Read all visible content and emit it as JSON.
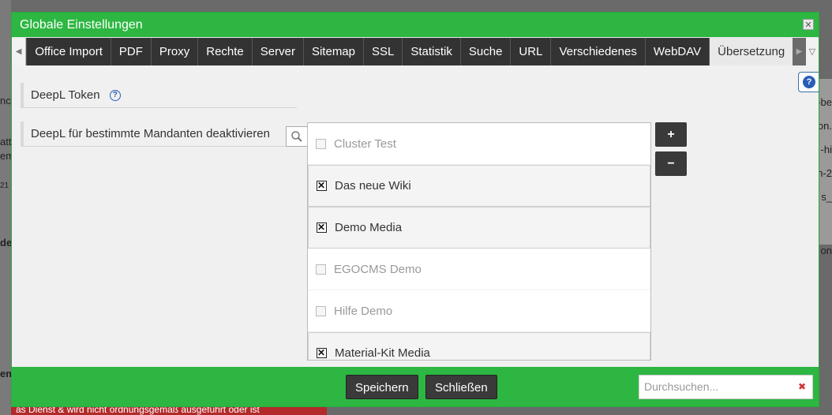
{
  "dialog": {
    "title": "Globale Einstellungen",
    "close_label": "✕"
  },
  "tabs": [
    {
      "label": "Office Import",
      "active": false
    },
    {
      "label": "PDF",
      "active": false
    },
    {
      "label": "Proxy",
      "active": false
    },
    {
      "label": "Rechte",
      "active": false
    },
    {
      "label": "Server",
      "active": false
    },
    {
      "label": "Sitemap",
      "active": false
    },
    {
      "label": "SSL",
      "active": false
    },
    {
      "label": "Statistik",
      "active": false
    },
    {
      "label": "Suche",
      "active": false
    },
    {
      "label": "URL",
      "active": false
    },
    {
      "label": "Verschiedenes",
      "active": false
    },
    {
      "label": "WebDAV",
      "active": false
    },
    {
      "label": "Übersetzung",
      "active": true
    }
  ],
  "form": {
    "token_label": "DeepL Token",
    "token_value": "",
    "deactivate_label": "DeepL für bestimmte Mandanten deaktivieren",
    "help_glyph": "?",
    "add_label": "+",
    "remove_label": "−"
  },
  "clients": [
    {
      "name": "Cluster Test",
      "checked": false
    },
    {
      "name": "Das neue Wiki",
      "checked": true
    },
    {
      "name": "Demo Media",
      "checked": true
    },
    {
      "name": "EGOCMS Demo",
      "checked": false
    },
    {
      "name": "Hilfe Demo",
      "checked": false
    },
    {
      "name": "Material-Kit Media",
      "checked": true
    }
  ],
  "footer": {
    "save_label": "Speichern",
    "close_label": "Schließen",
    "search_placeholder": "Durchsuchen...",
    "clear_glyph": "✖"
  },
  "background": {
    "fragments": [
      "em",
      "nch",
      "att",
      "21",
      "de",
      "em",
      "-be",
      "on.",
      "-hi",
      "n-2",
      "s_",
      "on"
    ],
    "footer_text": "as Dienst & wird nicht ordnungsgemäß ausgeführt oder ist"
  },
  "icons": {
    "help": "help-icon",
    "search": "magnifier-icon",
    "close": "close-icon",
    "scroll_left": "triangle-left-icon",
    "scroll_right": "triangle-right-icon",
    "menu": "chevron-down-icon"
  },
  "colors": {
    "accent": "#2db742",
    "dark_button": "#3a3a3a",
    "help_blue": "#2a5eb6"
  }
}
